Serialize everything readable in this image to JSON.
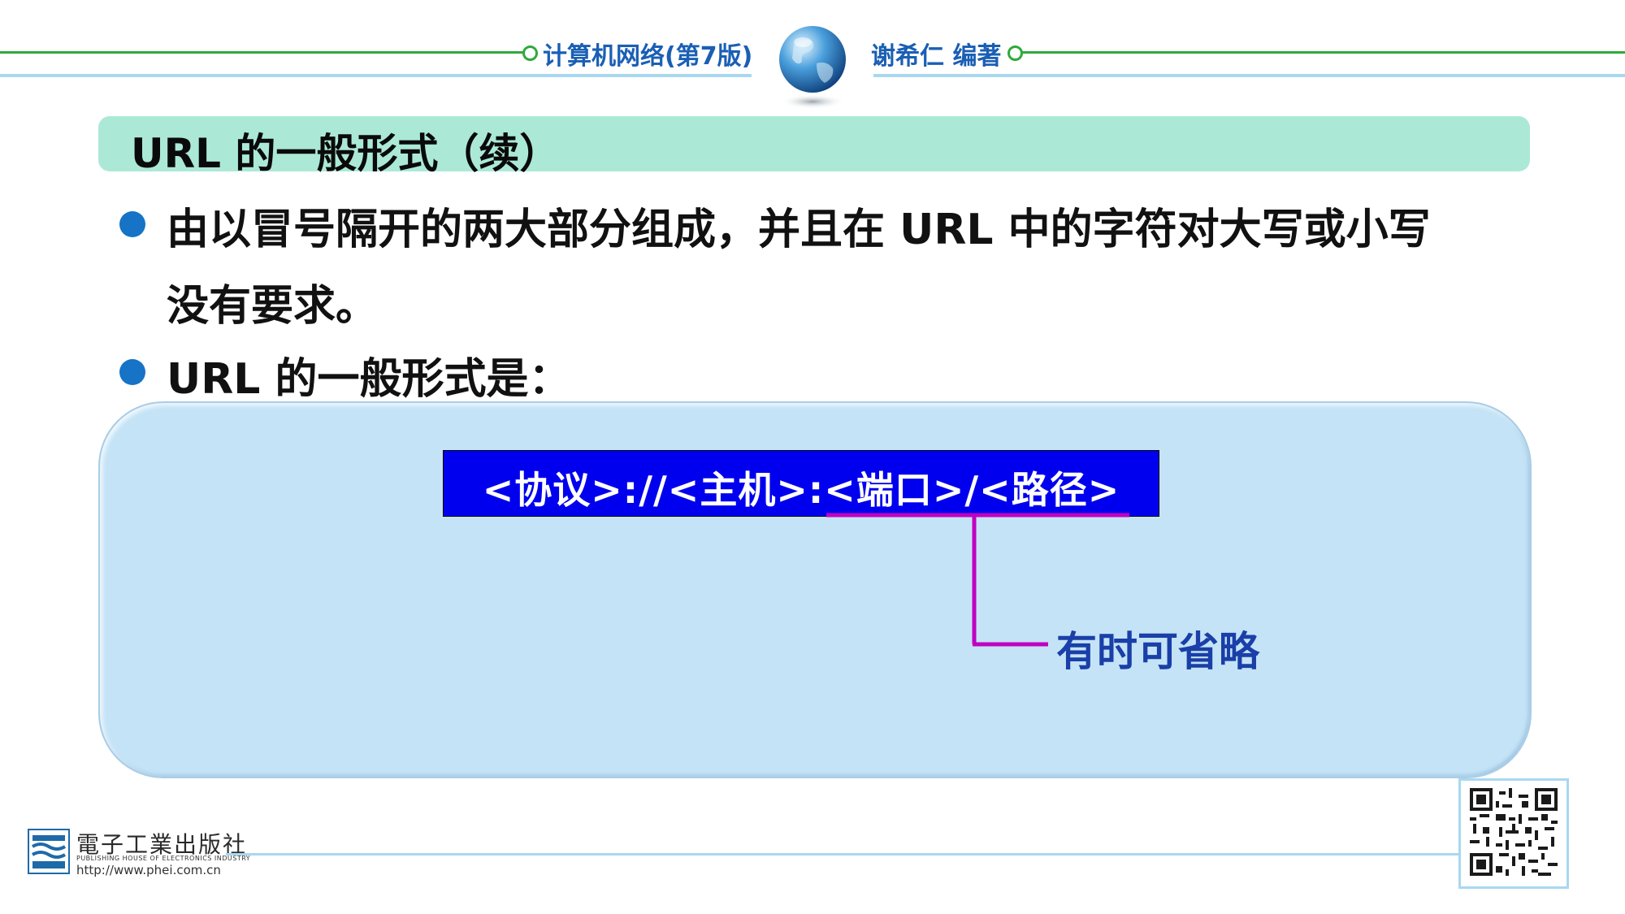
{
  "header": {
    "book_title": "计算机网络(第7版)",
    "author": "谢希仁 编著"
  },
  "slide": {
    "title": "URL 的一般形式（续）",
    "bullets": [
      {
        "lines": [
          "由以冒号隔开的两大部分组成，并且在 URL 中的字符对大写或小写",
          "没有要求。"
        ]
      },
      {
        "lines": [
          "URL 的一般形式是："
        ]
      }
    ]
  },
  "diagram": {
    "url_format": "<协议>://<主机>:<端口>/<路径>",
    "annotation": "有时可省略"
  },
  "footer": {
    "publisher": "電子工業出版社",
    "publisher_en": "PUBLISHING HOUSE OF ELECTRONICS INDUSTRY",
    "website": "http://www.phei.com.cn"
  },
  "colors": {
    "header_line_green": "#2eaa3c",
    "header_line_blue": "#a8d8f0",
    "title_bar": "#abe9d6",
    "bullet": "#1673c6",
    "url_box": "#0000ee",
    "bracket": "#c000c0",
    "annotation_text": "#1a3fa8"
  },
  "icons": {
    "globe": "globe-icon",
    "publisher_logo": "publisher-logo-icon",
    "qr_code": "qr-code-icon"
  }
}
